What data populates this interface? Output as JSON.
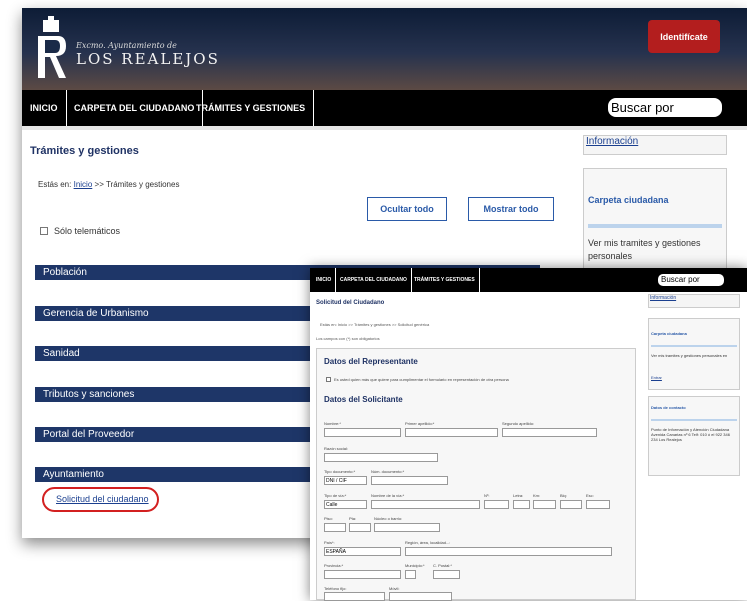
{
  "header": {
    "logo_subtitle": "Excmo. Ayuntamiento de",
    "logo_title": "LOS REALEJOS",
    "identify_button": "Identifícate"
  },
  "nav": {
    "items": [
      "INICIO",
      "CARPETA DEL CIUDADANO",
      "TRÁMITES Y GESTIONES"
    ],
    "search_placeholder": "Buscar por"
  },
  "main": {
    "title": "Trámites y gestiones",
    "breadcrumb_prefix": "Estás en:",
    "breadcrumb_home": "Inicio",
    "breadcrumb_current": ">> Trámites y gestiones",
    "hide_all": "Ocultar todo",
    "show_all": "Mostrar todo",
    "telematic_checkbox": "Sólo telemáticos",
    "categories": [
      "Población",
      "Gerencia de Urbanismo",
      "Sanidad",
      "Tributos y sanciones",
      "Portal del Proveedor",
      "Ayuntamiento"
    ],
    "request_link": "Solicitud del ciudadano"
  },
  "sidebar": {
    "info_link": "Información",
    "folder_title": "Carpeta ciudadana",
    "folder_text": "Ver mis tramites y gestiones personales"
  },
  "form_window": {
    "nav_items": [
      "INICIO",
      "CARPETA DEL CIUDADANO",
      "TRÁMITES Y GESTIONES"
    ],
    "search_placeholder": "Buscar por",
    "title": "Solicitud del Ciudadano",
    "breadcrumb": "Estás en: Inicio >> Trámites y gestiones >> Solicitud genérica",
    "required_note": "Los campos con (*) son obligatorios",
    "rep_section": "Datos del Representante",
    "rep_check": "Es usted quien más que quiere para cumplimentar el formulario en representación de otra persona",
    "applicant_section": "Datos del Solicitante",
    "labels": {
      "nombre": "Nombre:*",
      "apellido1": "Primer apellido:*",
      "apellido2": "Segundo apellido:",
      "razon": "Razón social:",
      "tipo_doc": "Tipo documento:*",
      "num_doc": "Núm. documento:*",
      "tipo_via": "Tipo de vía:*",
      "nombre_via": "Nombre de la vía:*",
      "num": "Nº:",
      "letra": "Letra:",
      "km": "Km:",
      "bloque": "Blq:",
      "esc": "Esc:",
      "piso": "Piso:",
      "pta": "Pta:",
      "nucleo": "Núcleo o barrio:",
      "pais": "País*:",
      "region": "Región, área, localidad...:",
      "provincia": "Provincia:*",
      "municipio": "Municipio:*",
      "cpostal": "C. Postal:*",
      "telefono": "Teléfono fijo:",
      "movil": "Móvil:"
    },
    "selects": {
      "doc_type": "DNI / CIF",
      "via_type": "Calle",
      "country": "ESPAÑA"
    },
    "side_info": "Información",
    "side_folder_title": "Carpeta ciudadana",
    "side_folder_text": "Ver mis tramites y gestiones personales en",
    "side_folder_link": "Entrar",
    "side_contact_title": "Datos de contacto",
    "side_contact_text": "Punto de Información y Atención Ciudadana Avenida Canarias nº 6 Telf: 010 ó el 922 346 234 Los Realejos"
  },
  "colors": {
    "nav_bg": "#000000",
    "category_bg": "#1e3668",
    "accent_blue": "#2a5aa8",
    "identify_red": "#b31e1e",
    "highlight_red": "#d32020"
  }
}
